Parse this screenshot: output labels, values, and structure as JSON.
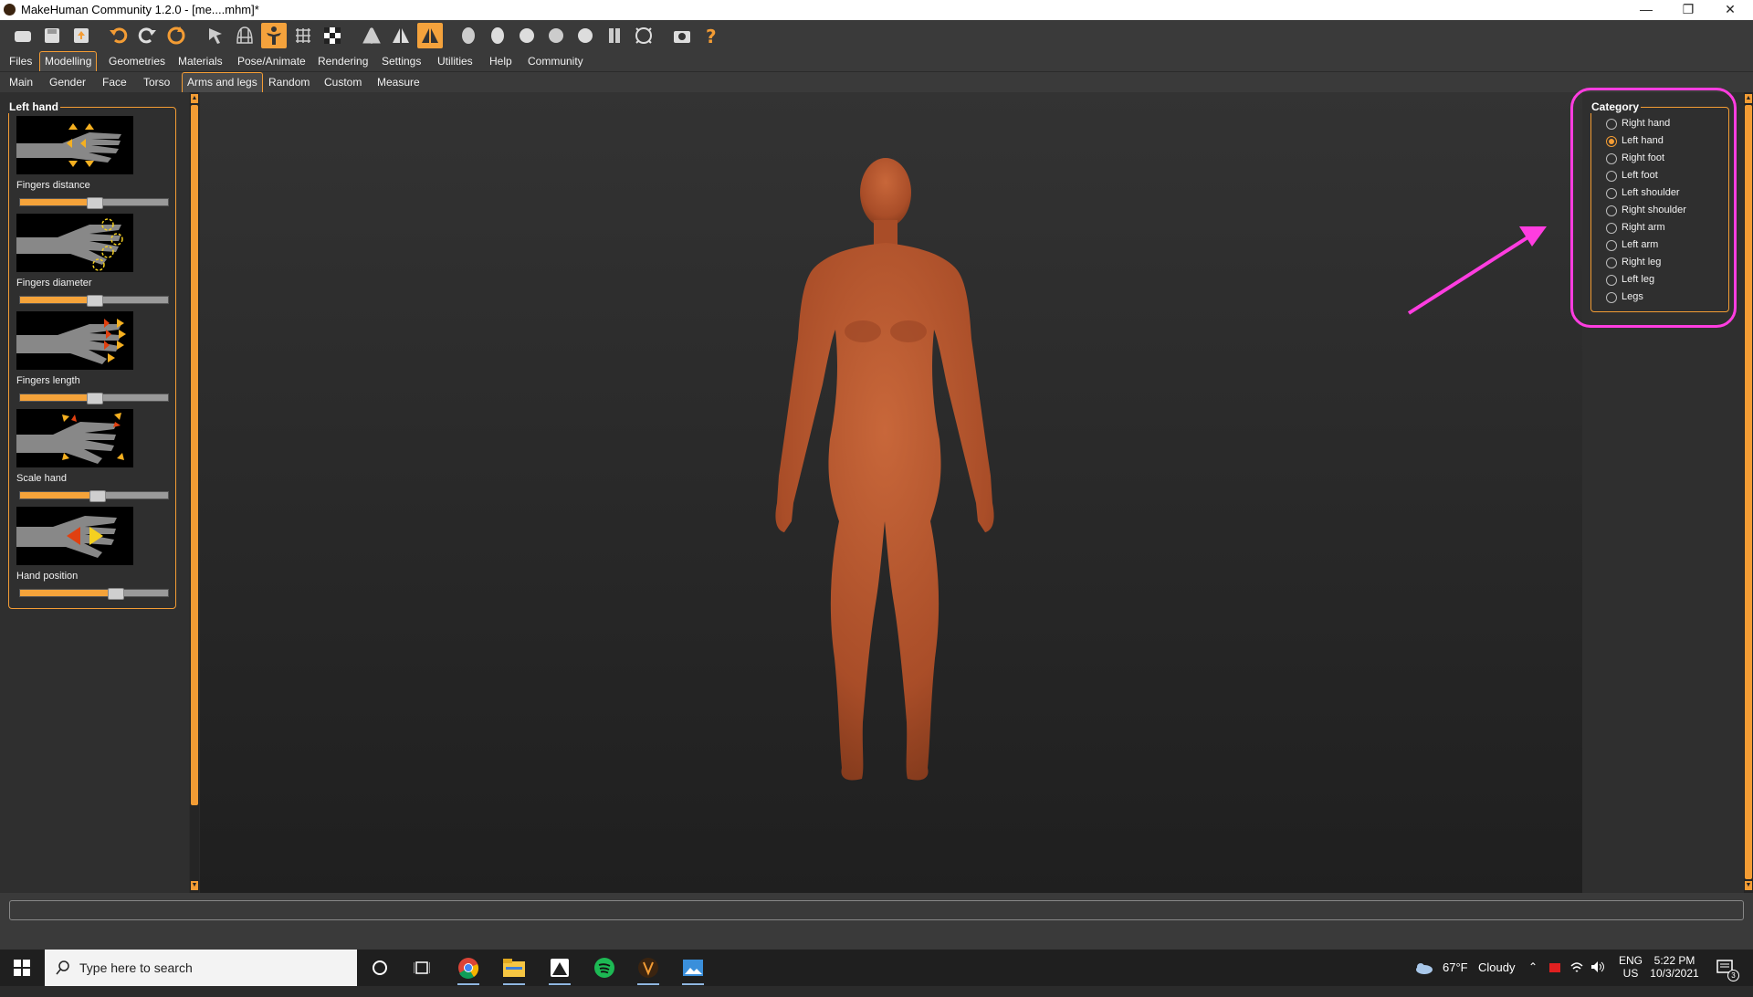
{
  "window": {
    "title": "MakeHuman Community 1.2.0 - [me....mhm]*"
  },
  "menu": [
    "Files",
    "Modelling",
    "Geometries",
    "Materials",
    "Pose/Animate",
    "Rendering",
    "Settings",
    "Utilities",
    "Help",
    "Community"
  ],
  "subtabs": [
    "Main",
    "Gender",
    "Face",
    "Torso",
    "Arms and legs",
    "Random",
    "Custom",
    "Measure"
  ],
  "left_panel": {
    "title": "Left hand",
    "modifiers": [
      {
        "label": "Fingers distance",
        "value": 0.5
      },
      {
        "label": "Fingers diameter",
        "value": 0.5
      },
      {
        "label": "Fingers length",
        "value": 0.5
      },
      {
        "label": "Scale hand",
        "value": 0.52
      },
      {
        "label": "Hand position",
        "value": 0.64
      }
    ]
  },
  "category": {
    "title": "Category",
    "selected": "Left hand",
    "options": [
      "Right hand",
      "Left hand",
      "Right foot",
      "Left foot",
      "Left shoulder",
      "Right shoulder",
      "Right arm",
      "Left arm",
      "Right leg",
      "Left leg",
      "Legs"
    ]
  },
  "taskbar": {
    "search_placeholder": "Type here to search",
    "weather_temp": "67°F",
    "weather_desc": "Cloudy",
    "lang": "ENG",
    "region": "US",
    "time": "5:22 PM",
    "date": "10/3/2021",
    "notifications": "3"
  },
  "colors": {
    "accent": "#f39c34",
    "annotation": "#ff3de0",
    "skin": "#b2552f"
  }
}
